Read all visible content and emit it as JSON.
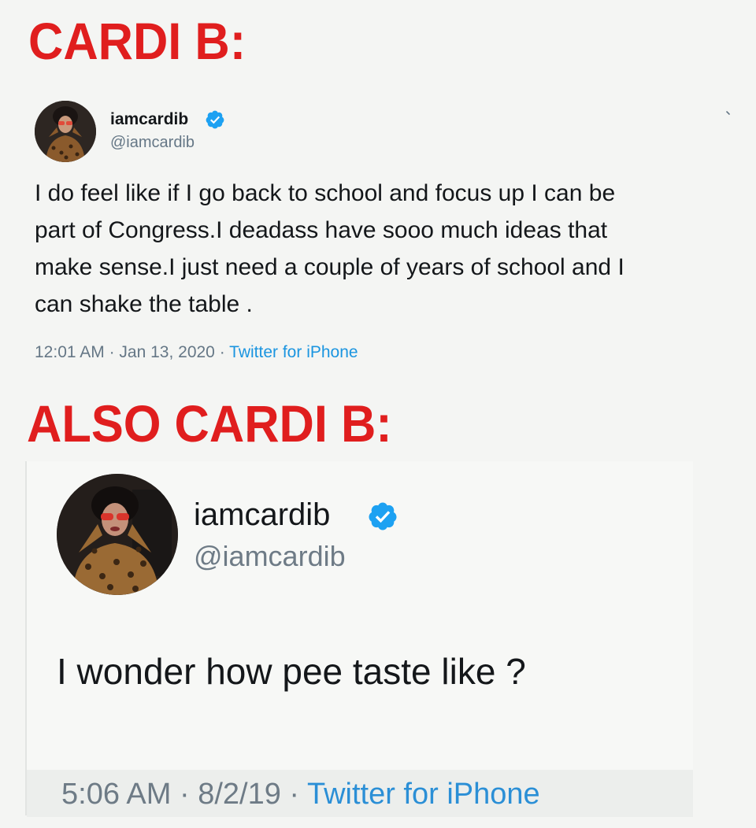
{
  "captions": {
    "top": "CARDI B:",
    "middle": "ALSO CARDI B:"
  },
  "colors": {
    "caption_red": "#e01e1e",
    "twitter_blue": "#1da1f2",
    "meta_gray": "#657786"
  },
  "tweets": [
    {
      "display_name": "iamcardib",
      "handle": "@iamcardib",
      "verified": true,
      "verified_icon": "verified-badge-icon",
      "menu_icon": "chevron-down-icon",
      "text": "I do feel like if I go back to school and focus up I can be\npart of Congress.I deadass have sooo much ideas that\nmake sense.I just need a couple of years of school and I\ncan  shake the table .",
      "time": "12:01 AM",
      "date": "Jan 13, 2020",
      "separator": "·",
      "source": "Twitter for iPhone"
    },
    {
      "display_name": "iamcardib",
      "handle": "@iamcardib",
      "verified": true,
      "verified_icon": "verified-badge-icon",
      "text": "I wonder how pee taste like ?",
      "time": "5:06 AM",
      "date": "8/2/19",
      "separator": "·",
      "source": "Twitter for iPhone"
    }
  ]
}
